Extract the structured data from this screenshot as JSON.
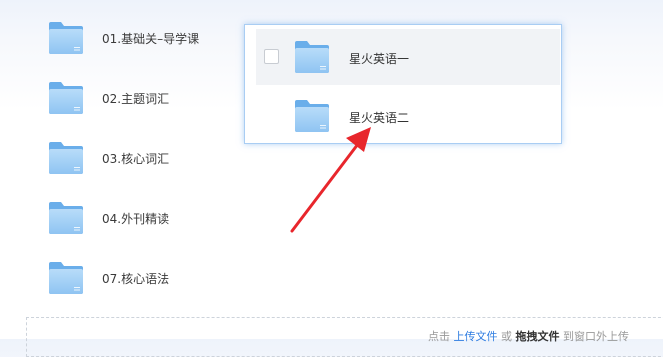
{
  "folders": [
    {
      "label": "01.基础关–导学课"
    },
    {
      "label": "02.主题词汇"
    },
    {
      "label": "03.核心词汇"
    },
    {
      "label": "04.外刊精读"
    },
    {
      "label": "07.核心语法"
    }
  ],
  "popup": {
    "items": [
      {
        "label": "星火英语一"
      },
      {
        "label": "星火英语二"
      }
    ]
  },
  "upload": {
    "prefix": "点击",
    "link": "上传文件",
    "middle": "或",
    "strong": "拖拽文件",
    "suffix": "到窗口外上传"
  },
  "colors": {
    "folder_light": "#a9d4f7",
    "folder_dark": "#5ea7e8",
    "arrow": "#e8262c",
    "popup_border": "#a9cdf3",
    "link": "#2f7de1"
  },
  "icons": [
    "folder-icon",
    "checkbox",
    "arrow"
  ]
}
